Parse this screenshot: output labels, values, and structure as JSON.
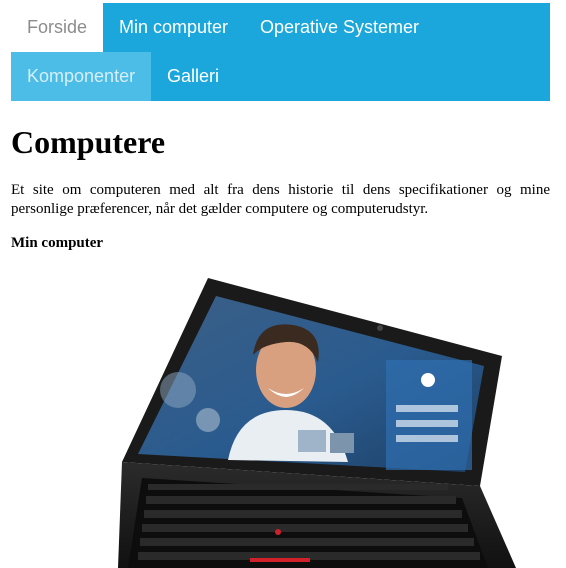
{
  "nav": {
    "items": [
      {
        "label": "Forside"
      },
      {
        "label": "Min computer"
      },
      {
        "label": "Operative Systemer"
      },
      {
        "label": "Komponenter"
      },
      {
        "label": "Galleri"
      }
    ]
  },
  "content": {
    "title": "Computere",
    "intro": "Et site om computeren med alt fra dens historie til dens specifikationer og mine personlige præferencer, når det gælder computere og computerudstyr.",
    "subheading": "Min computer"
  },
  "colors": {
    "nav_bg": "#1ba6dc",
    "nav_active": "#4bbde6",
    "nav_home_bg": "#ffffff",
    "nav_home_text": "#8c8c8c"
  }
}
